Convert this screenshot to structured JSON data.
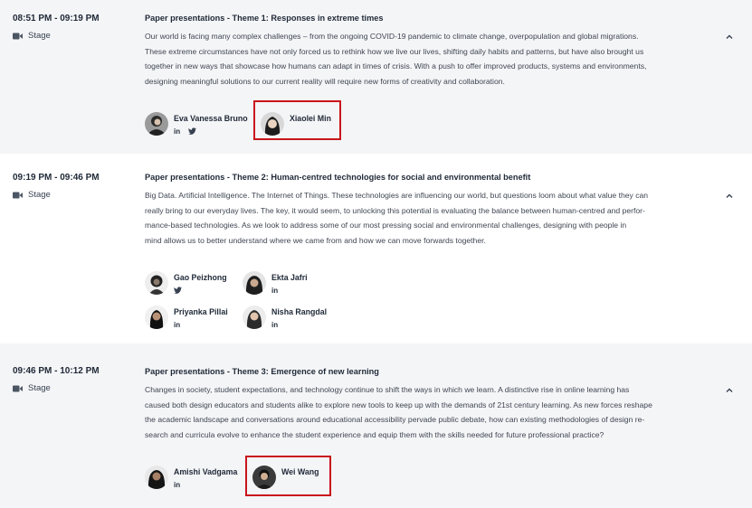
{
  "sessions": [
    {
      "time": "08:51 PM - 09:19 PM",
      "venue": "Stage",
      "title": "Paper presentations - Theme 1: Responses in extreme times",
      "description": [
        "Our world is facing many complex challenges – from the ongoing COVID-19 pandemic to climate change, overpopulation and global migrations.",
        "These extreme circumstances have not only forced us to rethink how we live our lives, shifting daily habits and patterns, but have also brought us",
        "together in new ways that showcase how humans can adapt in times of crisis. With a push to offer improved products, systems and environments,",
        "designing meaningful solutions to our current reality will require new forms of creativity and collaboration."
      ],
      "speakers": [
        {
          "name": "Eva Vanessa Bruno",
          "socials": [
            "in",
            "twitter-icon"
          ]
        },
        {
          "name": "Xiaolei Min",
          "socials": []
        }
      ]
    },
    {
      "time": "09:19 PM - 09:46 PM",
      "venue": "Stage",
      "title": "Paper presentations - Theme 2: Human-centred technologies for social and environmental benefit",
      "description": [
        "Big Data. Artificial Intelligence. The Internet of Things. These technologies are influencing our world, but questions loom about what value they can",
        "really bring to our everyday lives. The key, it would seem, to unlocking this potential is evaluating the balance between human-centred and perfor-",
        "mance-based technologies. As we look to address some of our most pressing social and environmental challenges, designing with people in",
        "mind allows us to better understand where we came from and how we can move forwards together."
      ],
      "speakers": [
        {
          "name": "Gao Peizhong",
          "socials": [
            "twitter-icon"
          ]
        },
        {
          "name": "Ekta Jafri",
          "socials": [
            "in"
          ]
        },
        {
          "name": "Priyanka Pillai",
          "socials": [
            "in"
          ]
        },
        {
          "name": "Nisha Rangdal",
          "socials": [
            "in"
          ]
        }
      ]
    },
    {
      "time": "09:46 PM - 10:12 PM",
      "venue": "Stage",
      "title": "Paper presentations - Theme 3: Emergence of new learning",
      "description": [
        "Changes in society, student expectations, and technology continue to shift the ways in which we learn. A distinctive rise in online learning has",
        "caused both design educators and students alike to explore new tools to keep up with the demands of 21st century learning. As new forces reshape",
        "the academic landscape and conversations around educational accessibility pervade public debate, how can existing methodologies of design re-",
        "search and curricula evolve to enhance the student experience and equip them with the skills needed for future professional practice?"
      ],
      "speakers": [
        {
          "name": "Amishi Vadgama",
          "socials": [
            "in"
          ]
        },
        {
          "name": "Wei Wang",
          "socials": []
        }
      ]
    }
  ],
  "icons": {
    "venue": "video-camera-icon",
    "collapse": "chevron-up-icon",
    "linkedin_text": "in"
  },
  "colors": {
    "highlight": "#c8151b",
    "row_alt": "#f4f5f7",
    "text": "#1f2937"
  }
}
